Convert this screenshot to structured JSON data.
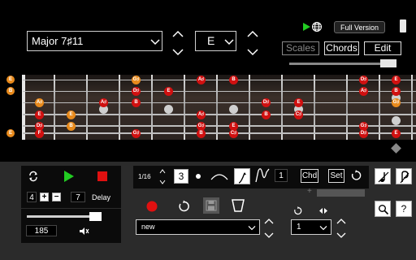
{
  "scale_select": {
    "value": "Major 7♯11"
  },
  "key_select": {
    "value": "E"
  },
  "top_buttons": {
    "full_version": "Full Version",
    "scales": "Scales",
    "chords": "Chords",
    "edit": "Edit"
  },
  "fretboard": {
    "open_notes": [
      "E",
      "B",
      "",
      "",
      "",
      "E"
    ],
    "notes": [
      {
        "fret": 4,
        "string": 1,
        "label": "G♯",
        "color": "orange"
      },
      {
        "fret": 6,
        "string": 1,
        "label": "A♯",
        "color": "red"
      },
      {
        "fret": 7,
        "string": 1,
        "label": "B",
        "color": "red"
      },
      {
        "fret": 11,
        "string": 1,
        "label": "D♯",
        "color": "red"
      },
      {
        "fret": 12,
        "string": 1,
        "label": "E",
        "color": "red"
      },
      {
        "fret": 4,
        "string": 2,
        "label": "D♯",
        "color": "red"
      },
      {
        "fret": 5,
        "string": 2,
        "label": "E",
        "color": "red"
      },
      {
        "fret": 11,
        "string": 2,
        "label": "A♯",
        "color": "red"
      },
      {
        "fret": 12,
        "string": 2,
        "label": "B",
        "color": "red"
      },
      {
        "fret": 1,
        "string": 3,
        "label": "A♯",
        "color": "orange"
      },
      {
        "fret": 3,
        "string": 3,
        "label": "A♯",
        "color": "red"
      },
      {
        "fret": 4,
        "string": 3,
        "label": "B",
        "color": "red"
      },
      {
        "fret": 8,
        "string": 3,
        "label": "D♯",
        "color": "red"
      },
      {
        "fret": 9,
        "string": 3,
        "label": "E",
        "color": "red"
      },
      {
        "fret": 12,
        "string": 3,
        "label": "G♯",
        "color": "orange"
      },
      {
        "fret": 1,
        "string": 4,
        "label": "E",
        "color": "red"
      },
      {
        "fret": 2,
        "string": 4,
        "label": "E",
        "color": "orange"
      },
      {
        "fret": 6,
        "string": 4,
        "label": "A♯",
        "color": "red"
      },
      {
        "fret": 8,
        "string": 4,
        "label": "B",
        "color": "red"
      },
      {
        "fret": 9,
        "string": 4,
        "label": "C♯",
        "color": "red"
      },
      {
        "fret": 1,
        "string": 5,
        "label": "D♯",
        "color": "red"
      },
      {
        "fret": 2,
        "string": 5,
        "label": "B",
        "color": "orange"
      },
      {
        "fret": 6,
        "string": 5,
        "label": "G♯",
        "color": "red"
      },
      {
        "fret": 7,
        "string": 5,
        "label": "E",
        "color": "red"
      },
      {
        "fret": 11,
        "string": 5,
        "label": "G♯",
        "color": "red"
      },
      {
        "fret": 1,
        "string": 6,
        "label": "F",
        "color": "red"
      },
      {
        "fret": 4,
        "string": 6,
        "label": "G♯",
        "color": "red"
      },
      {
        "fret": 6,
        "string": 6,
        "label": "B",
        "color": "red"
      },
      {
        "fret": 7,
        "string": 6,
        "label": "C♯",
        "color": "red"
      },
      {
        "fret": 11,
        "string": 6,
        "label": "D♯",
        "color": "red"
      },
      {
        "fret": 12,
        "string": 6,
        "label": "E",
        "color": "red"
      }
    ]
  },
  "player": {
    "count": "4",
    "plus": "+",
    "minus": "−",
    "delay_value": "7",
    "delay_label": "Delay",
    "tempo": "185",
    "volume_level": 0.9
  },
  "editor": {
    "note_length": "1/16",
    "step_value": "3",
    "chain_value": "1",
    "chord_button": "Chd",
    "set_button": "Set",
    "plus": "+",
    "sequence_select": "new",
    "repeat_select": "1"
  },
  "colors": {
    "note_red": "#d01010",
    "note_orange": "#e88a1c",
    "record_red": "#e01010",
    "play_green": "#22cc22"
  }
}
